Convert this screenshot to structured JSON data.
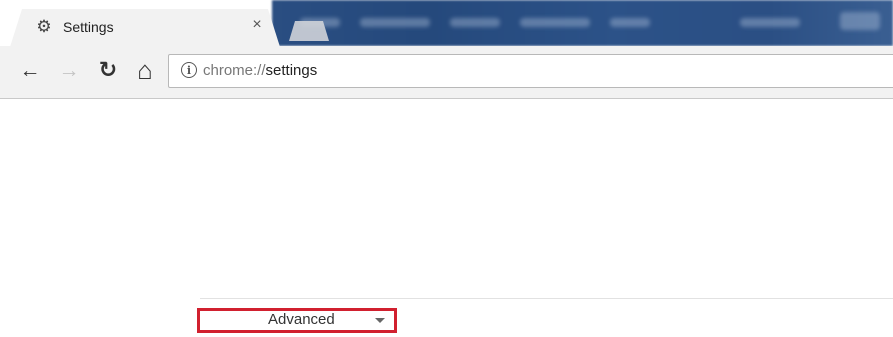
{
  "browser": {
    "tab": {
      "icon": "gear-icon",
      "title": "Settings",
      "close_icon": "close-icon",
      "close_glyph": "×"
    },
    "toolbar": {
      "back_glyph": "←",
      "forward_glyph": "→",
      "reload_glyph": "↻",
      "home_glyph": "⌂",
      "info_glyph": "i",
      "url_scheme": "chrome://",
      "url_path": "settings"
    }
  },
  "page": {
    "advanced_button": {
      "label": "Advanced",
      "icon": "dropdown-arrow-icon",
      "highlight_color": "#d1202f"
    }
  }
}
